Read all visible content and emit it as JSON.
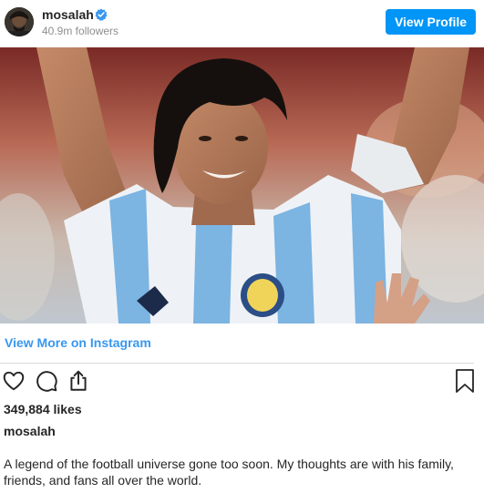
{
  "header": {
    "username": "mosalah",
    "followers": "40.9m followers",
    "view_profile_label": "View Profile",
    "verified_icon": "verified-badge-icon",
    "accent": "#0095f6"
  },
  "post": {
    "view_more_label": "View More on Instagram",
    "likes": "349,884 likes",
    "caption_user": "mosalah",
    "caption": "A legend of the football universe gone too soon. My thoughts are with his family, friends, and fans all over the world."
  },
  "actions": {
    "like_icon": "heart-icon",
    "comment_icon": "comment-icon",
    "share_icon": "share-icon",
    "save_icon": "bookmark-icon"
  },
  "colors": {
    "link": "#3897f0",
    "text": "#262626",
    "muted": "#8e8e8e"
  }
}
